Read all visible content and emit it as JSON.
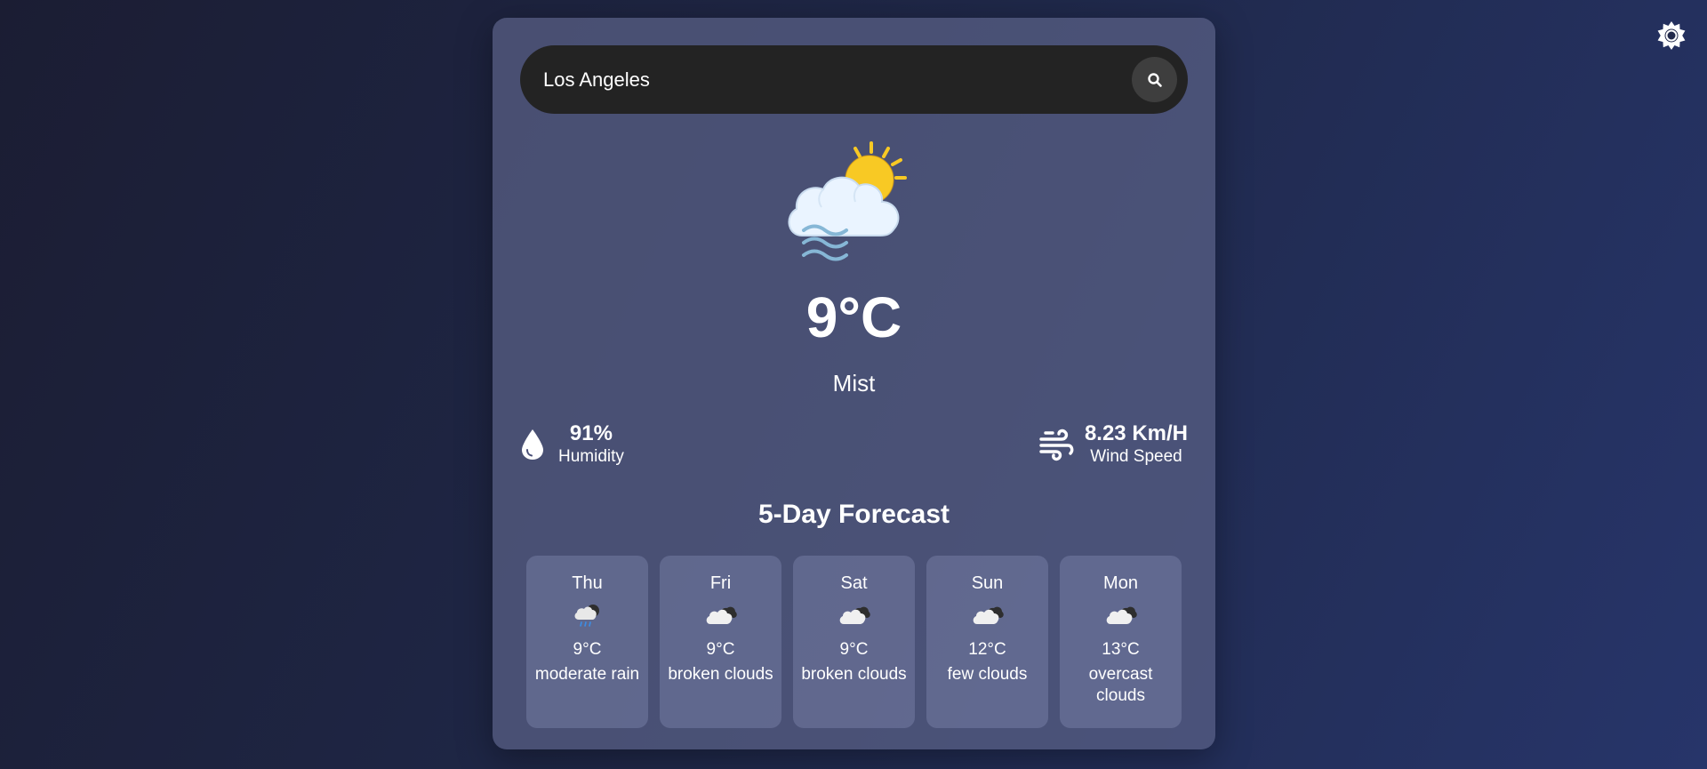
{
  "search": {
    "value": "Los Angeles",
    "placeholder": ""
  },
  "current": {
    "temperature": "9°C",
    "description": "Mist",
    "icon": "mist-sun-cloud-icon"
  },
  "stats": {
    "humidity": {
      "value": "91%",
      "label": "Humidity",
      "icon": "droplet-icon"
    },
    "wind": {
      "value": "8.23 Km/H",
      "label": "Wind Speed",
      "icon": "wind-icon"
    }
  },
  "forecast": {
    "title": "5-Day Forecast",
    "days": [
      {
        "day": "Thu",
        "temp": "9°C",
        "desc": "moderate rain",
        "icon": "rain-cloud-icon"
      },
      {
        "day": "Fri",
        "temp": "9°C",
        "desc": "broken clouds",
        "icon": "broken-clouds-icon"
      },
      {
        "day": "Sat",
        "temp": "9°C",
        "desc": "broken clouds",
        "icon": "broken-clouds-icon"
      },
      {
        "day": "Sun",
        "temp": "12°C",
        "desc": "few clouds",
        "icon": "few-clouds-icon"
      },
      {
        "day": "Mon",
        "temp": "13°C",
        "desc": "overcast clouds",
        "icon": "overcast-clouds-icon"
      }
    ]
  },
  "colors": {
    "background_start": "#1b1d33",
    "background_end": "#27356a",
    "card": "#5a6187",
    "search_bar": "#232323",
    "sun": "#f8c924",
    "text": "#ffffff"
  }
}
